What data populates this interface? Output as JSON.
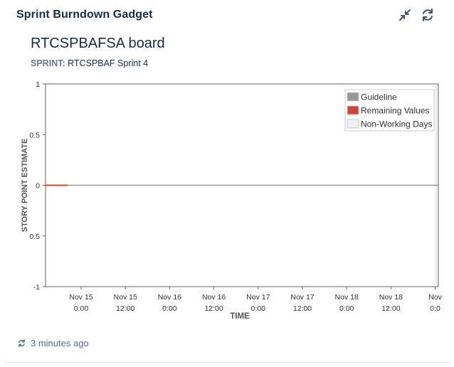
{
  "gadget": {
    "title": "Sprint Burndown Gadget",
    "minimize_icon": "collapse-arrows-icon",
    "refresh_icon": "refresh-icon"
  },
  "board": {
    "name": "RTCSPBAFSA board",
    "sprint_label": "SPRINT:",
    "sprint_value": "RTCSPBAF Sprint 4"
  },
  "footer": {
    "refresh_icon": "refresh-icon",
    "updated": "3 minutes ago"
  },
  "colors": {
    "guideline": "#999999",
    "remaining": "#d04437",
    "non_working": "#f0f0f0",
    "axis": "#666666"
  },
  "chart_data": {
    "type": "line",
    "xlabel": "TIME",
    "ylabel": "STORY POINT ESTIMATE",
    "ylim": [
      -1,
      1
    ],
    "y_ticks": [
      "1",
      "0.5",
      "0",
      "0.5",
      "-1"
    ],
    "x_ticks": [
      [
        "Nov 15",
        "0:00"
      ],
      [
        "Nov 15",
        "12:00"
      ],
      [
        "Nov 16",
        "0:00"
      ],
      [
        "Nov 16",
        "12:00"
      ],
      [
        "Nov 17",
        "0:00"
      ],
      [
        "Nov 17",
        "12:00"
      ],
      [
        "Nov 18",
        "0:00"
      ],
      [
        "Nov 18",
        "12:00"
      ],
      [
        "Nov",
        "0:0"
      ]
    ],
    "legend_position": "top-right",
    "grid": false,
    "series": [
      {
        "name": "Guideline",
        "values": [
          [
            0,
            0
          ],
          [
            9,
            0
          ]
        ]
      },
      {
        "name": "Remaining Values",
        "values": [
          [
            0,
            0
          ],
          [
            0.5,
            0
          ]
        ]
      },
      {
        "name": "Non-Working Days",
        "values": []
      }
    ]
  }
}
